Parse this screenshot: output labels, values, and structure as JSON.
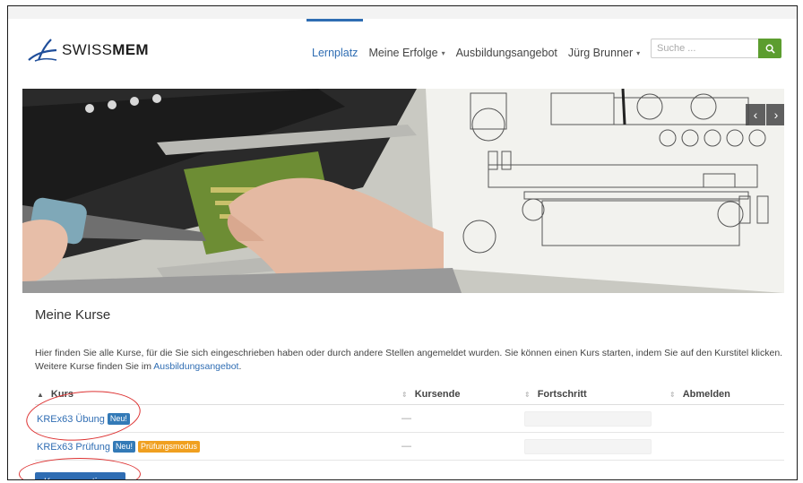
{
  "brand": {
    "logo_text_light": "SWISS",
    "logo_text_bold": "MEM"
  },
  "nav": {
    "items": [
      {
        "label": "Lernplatz",
        "active": true,
        "dropdown": false
      },
      {
        "label": "Meine Erfolge",
        "active": false,
        "dropdown": true
      },
      {
        "label": "Ausbildungsangebot",
        "active": false,
        "dropdown": false
      },
      {
        "label": "Jürg Brunner",
        "active": false,
        "dropdown": true
      }
    ],
    "caret_glyph": "▾"
  },
  "search": {
    "placeholder": "Suche ...",
    "value": ""
  },
  "carousel": {
    "prev_glyph": "‹",
    "next_glyph": "›"
  },
  "main": {
    "title": "Meine Kurse",
    "intro_text": "Hier finden Sie alle Kurse, für die Sie sich eingeschrieben haben oder durch andere Stellen angemeldet wurden. Sie können einen Kurs starten, indem Sie auf den Kurstitel klicken. Weitere Kurse finden Sie im ",
    "intro_link": "Ausbildungsangebot",
    "intro_end": ".",
    "table": {
      "columns": [
        "Kurs",
        "Kursende",
        "Fortschritt",
        "Abmelden"
      ],
      "rows": [
        {
          "course": "KREx63 Übung",
          "badges": [
            "Neu!"
          ],
          "end": "—"
        },
        {
          "course": "KREx63 Prüfung",
          "badges": [
            "Neu!",
            "Prüfungsmodus"
          ],
          "end": "—"
        }
      ]
    },
    "repeat_button": "Kurse repetieren"
  },
  "colors": {
    "accent": "#2f6db3",
    "search_btn": "#5c9d2f",
    "badge_new": "#337ab7",
    "badge_exam": "#f0a020",
    "annotation": "#dd3333"
  },
  "icons": {
    "search": "search-icon",
    "logo": "swissmem-logo-icon"
  }
}
